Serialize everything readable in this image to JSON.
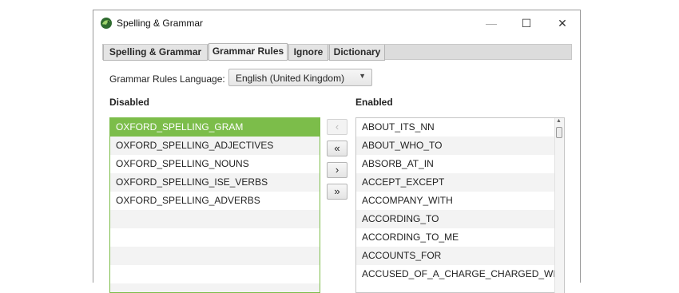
{
  "window": {
    "title": "Spelling & Grammar",
    "minimize": "—",
    "maximize": "☐",
    "close": "✕",
    "icon": "bird-logo-icon"
  },
  "tabs": [
    {
      "label": "Spelling & Grammar",
      "active": false
    },
    {
      "label": "Grammar Rules",
      "active": true
    },
    {
      "label": "Ignore",
      "active": false
    },
    {
      "label": "Dictionary",
      "active": false
    }
  ],
  "language": {
    "label": "Grammar Rules Language:",
    "value": "English (United Kingdom)",
    "arrow": "▼"
  },
  "disabled": {
    "heading": "Disabled",
    "items": [
      "OXFORD_SPELLING_GRAM",
      "OXFORD_SPELLING_ADJECTIVES",
      "OXFORD_SPELLING_NOUNS",
      "OXFORD_SPELLING_ISE_VERBS",
      "OXFORD_SPELLING_ADVERBS"
    ],
    "selected_index": 0
  },
  "enabled": {
    "heading": "Enabled",
    "items": [
      "ABOUT_ITS_NN",
      "ABOUT_WHO_TO",
      "ABSORB_AT_IN",
      "ACCEPT_EXCEPT",
      "ACCOMPANY_WITH",
      "ACCORDING_TO",
      "ACCORDING_TO_ME",
      "ACCOUNTS_FOR",
      "ACCUSED_OF_A_CHARGE_CHARGED_WITH"
    ]
  },
  "buttons": {
    "move_left": "‹",
    "move_all_left": "«",
    "move_right": "›",
    "move_all_right": "»"
  },
  "scrollbar": {
    "up_arrow": "▲"
  },
  "colors": {
    "accent": "#7cbd4a"
  }
}
